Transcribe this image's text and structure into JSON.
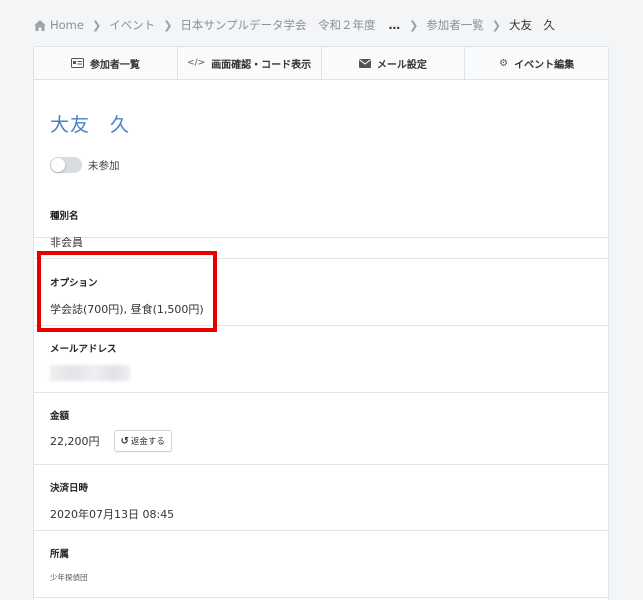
{
  "breadcrumb": {
    "home": "Home",
    "event": "イベント",
    "event_name": "日本サンプルデータ学会　令和２年度",
    "ellipsis": "…",
    "participants": "参加者一覧",
    "current": "大友　久"
  },
  "tabs": [
    {
      "label": "参加者一覧",
      "icon": "id-card-icon"
    },
    {
      "label": "画面確認・コード表示",
      "icon": "code-icon"
    },
    {
      "label": "メール設定",
      "icon": "envelope-icon"
    },
    {
      "label": "イベント編集",
      "icon": "gear-icon"
    }
  ],
  "participant": {
    "name": "大友　久",
    "attendance_label": "未参加",
    "attendance_on": false
  },
  "fields": {
    "type": {
      "label": "種別名",
      "value": "非会員"
    },
    "option": {
      "label": "オプション",
      "value": "学会誌(700円), 昼食(1,500円)"
    },
    "email": {
      "label": "メールアドレス"
    },
    "amount": {
      "label": "金額",
      "value": "22,200円",
      "refund_label": "返金する",
      "refund_icon": "undo-icon"
    },
    "paid_at": {
      "label": "決済日時",
      "value": "2020年07月13日 08:45"
    },
    "affiliation": {
      "label": "所属",
      "value": "少年探偵団"
    }
  },
  "colors": {
    "accent": "#4a82c8",
    "highlight": "#e60000"
  }
}
